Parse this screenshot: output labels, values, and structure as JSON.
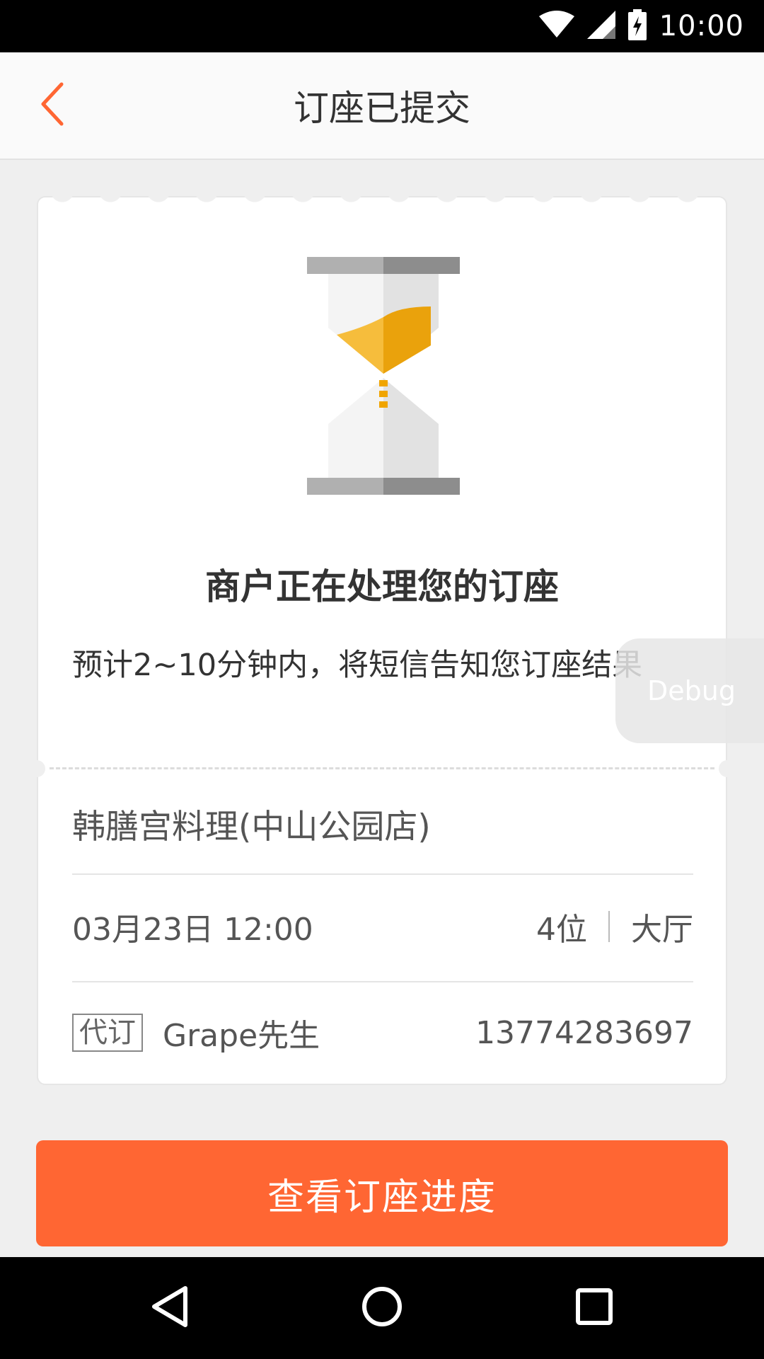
{
  "status_bar": {
    "time": "10:00",
    "icons": [
      "wifi-icon",
      "signal-icon",
      "battery-charging-icon"
    ]
  },
  "header": {
    "title": "订座已提交",
    "back_icon": "chevron-left-icon"
  },
  "status": {
    "icon": "hourglass-icon",
    "heading": "商户正在处理您的订座",
    "description": "预计2~10分钟内，将短信告知您订座结果"
  },
  "order": {
    "restaurant": "韩膳宫料理(中山公园店)",
    "datetime": "03月23日 12:00",
    "party_size": "4位",
    "area": "大厅",
    "tag": "代订",
    "contact_name": "Grape先生",
    "phone": "13774283697"
  },
  "actions": {
    "view_progress": "查看订座进度"
  },
  "debug": {
    "label": "Debug"
  },
  "colors": {
    "accent": "#ff6633",
    "hourglass_sand": "#f4b400"
  },
  "nav_bar": {
    "icons": [
      "back-triangle-icon",
      "home-circle-icon",
      "recents-square-icon"
    ]
  }
}
